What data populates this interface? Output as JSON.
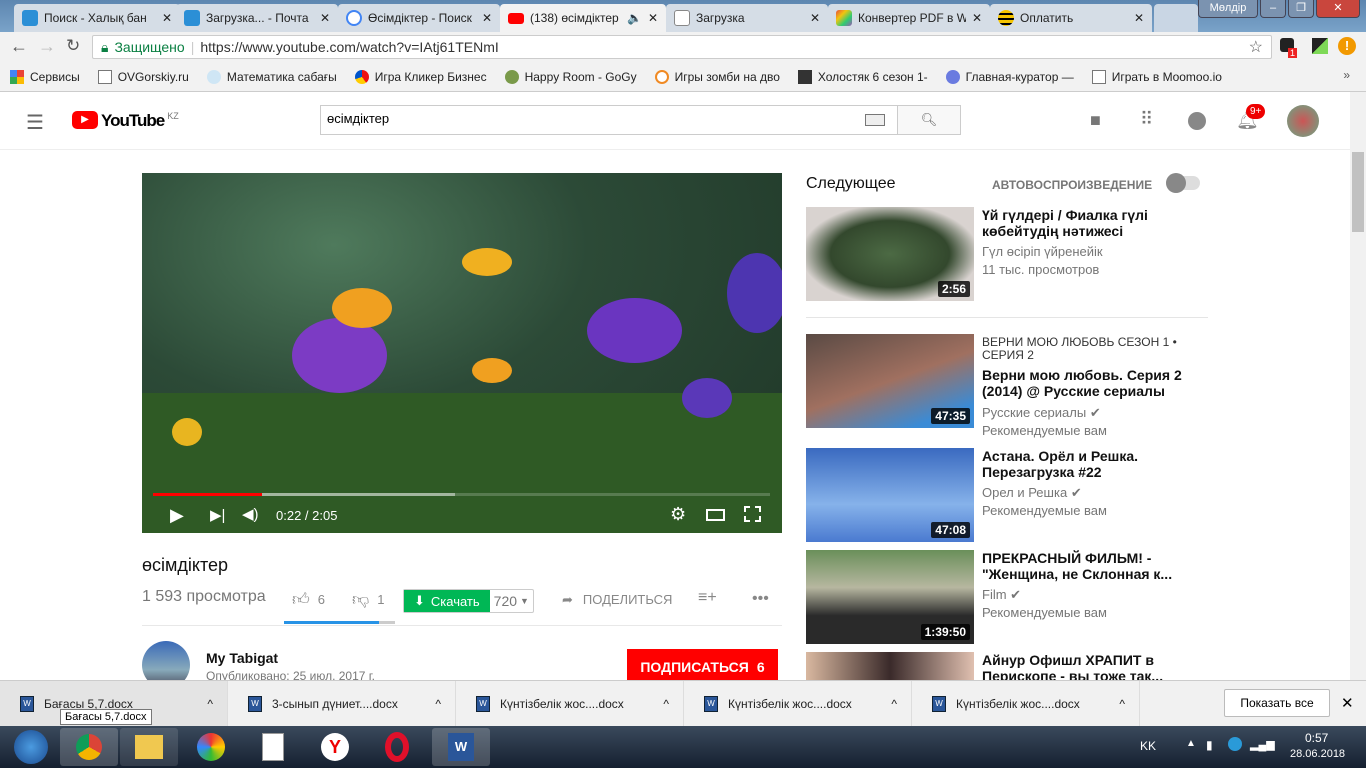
{
  "browser": {
    "tabs": [
      {
        "title": "Поиск - Халық бан",
        "icon": "mail-icon",
        "color": "#2b8fd6"
      },
      {
        "title": "Загрузка... - Почта",
        "icon": "mail-icon",
        "color": "#2b8fd6"
      },
      {
        "title": "Өсімдіктер - Поиск",
        "icon": "google-icon",
        "color": "#4285f4"
      },
      {
        "title": "(138) өсімдіктер",
        "icon": "youtube-icon",
        "color": "#ff0000"
      },
      {
        "title": "Загрузка",
        "icon": "page-icon",
        "color": "#ffffff"
      },
      {
        "title": "Конвертер PDF в W",
        "icon": "pdf-converter-icon",
        "color": "#9b59b6"
      },
      {
        "title": "Оплатить",
        "icon": "beeline-icon",
        "color": "#f5c400"
      }
    ],
    "user": "Мөлдір",
    "secure_label": "Защищено",
    "url": "https://www.youtube.com/watch?v=IAtj61TENmI",
    "ext_badge": "1",
    "bookmarks": [
      "Сервисы",
      "OVGorskiy.ru",
      "Математика сабағы",
      "Игра Кликер Бизнес",
      "Happy Room - GoGy",
      "Игры зомби на дво",
      "Холостяк 6 сезон 1-",
      "Главная-куратор —",
      "Играть в Moomoo.io"
    ]
  },
  "youtube": {
    "logo": "YouTube",
    "region": "KZ",
    "search_value": "өсімдіктер",
    "notif_count": "9+",
    "video": {
      "time": "0:22 / 2:05",
      "progress": 0.176,
      "buffered": 0.49
    },
    "title": "өсімдіктер",
    "views": "1 593 просмотра",
    "likes": "6",
    "dislikes": "1",
    "like_ratio": 0.857,
    "download_label": "Скачать",
    "quality": "720",
    "share_label": "ПОДЕЛИТЬСЯ",
    "channel": "My Tabigat",
    "published": "Опубликовано: 25 июл. 2017 г.",
    "subscribe_label": "ПОДПИСАТЬСЯ",
    "subscribe_count": "6",
    "next_label": "Следующее",
    "autoplay_label": "АВТОВОСПРОИЗВЕДЕНИЕ",
    "recs": [
      {
        "title": "Үй гүлдері / Фиалка гүлі көбейтудің нәтижесі",
        "channel": "Гүл өсіріп үйренейік",
        "meta": "11 тыс. просмотров",
        "duration": "2:56"
      },
      {
        "playlist": "ВЕРНИ МОЮ ЛЮБОВЬ  СЕЗОН 1 • СЕРИЯ 2",
        "title": "Верни мою любовь. Серия 2 (2014) @ Русские сериалы",
        "channel": "Русские сериалы",
        "meta": "Рекомендуемые вам",
        "duration": "47:35"
      },
      {
        "title": "Астана. Орёл и Решка. Перезагрузка #22",
        "channel": "Орел и Решка",
        "meta": "Рекомендуемые вам",
        "duration": "47:08"
      },
      {
        "title": "ПРЕКРАСНЫЙ ФИЛЬМ! - \"Женщина, не Склонная к...",
        "channel": "Film",
        "meta": "Рекомендуемые вам",
        "duration": "1:39:50"
      },
      {
        "title": "Айнур Офишл ХРАПИТ в Перископе - вы тоже так...",
        "channel": "",
        "meta": "",
        "duration": ""
      }
    ]
  },
  "downloads": {
    "items": [
      "Бағасы 5,7.docx",
      "3-сынып дүниет....docx",
      "Күнтізбелік жос....docx",
      "Күнтізбелік жос....docx",
      "Күнтізбелік жос....docx"
    ],
    "tooltip": "Бағасы 5,7.docx",
    "show_all": "Показать все"
  },
  "taskbar": {
    "lang": "KK",
    "time": "0:57",
    "date": "28.06.2018"
  }
}
